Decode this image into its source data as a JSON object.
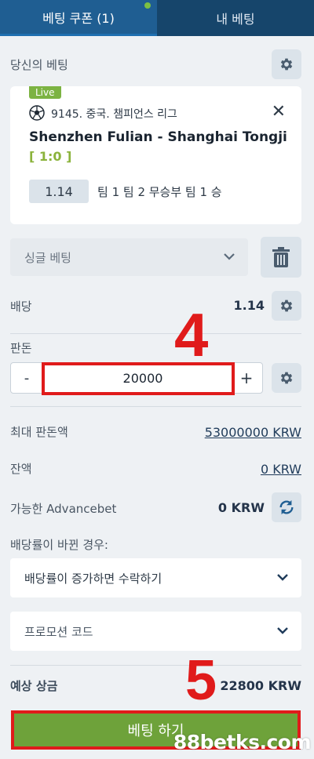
{
  "tabs": [
    {
      "label": "베팅 쿠폰 (1)",
      "active": true
    },
    {
      "label": "내 베팅",
      "active": false
    }
  ],
  "your_bets_label": "당신의 베팅",
  "bet": {
    "badge": "Live",
    "league": "9145. 중국. 챔피언스 리그",
    "match": "Shenzhen Fulian - Shanghai Tongji",
    "score": "[ 1:0 ]",
    "odd": "1.14",
    "selection": "팀 1 팀 2 무승부 팀 1 승"
  },
  "bet_type": "싱글 베팅",
  "odds_row": {
    "label": "배당",
    "value": "1.14"
  },
  "stake": {
    "label": "판돈",
    "minus": "-",
    "plus": "+",
    "value": "20000"
  },
  "max_stake": {
    "label": "최대 판돈액",
    "value": "53000000 KRW"
  },
  "balance": {
    "label": "잔액",
    "value": "0 KRW"
  },
  "advancebet": {
    "label": "가능한 Advancebet",
    "value": "0 KRW"
  },
  "odds_change": {
    "label": "배당률이 바뀐 경우:",
    "option": "배당률이 증가하면 수락하기"
  },
  "promo": {
    "placeholder": "프로모션 코드"
  },
  "potential_win": {
    "label": "예상 상금",
    "value": "22800 KRW"
  },
  "place_bet_label": "베팅 하기",
  "annotations": {
    "step4": "4",
    "step5": "5"
  },
  "watermark": "88betks.com",
  "colors": {
    "header": "#16456b",
    "tab_active": "#1f5e92",
    "live": "#7cb342",
    "score": "#8bb33c",
    "place_bet": "#6ea23a",
    "highlight": "#e01b1b"
  },
  "icons": [
    "gear-icon",
    "soccer-ball-icon",
    "close-icon",
    "chevron-down-icon",
    "trash-icon",
    "refresh-icon"
  ]
}
